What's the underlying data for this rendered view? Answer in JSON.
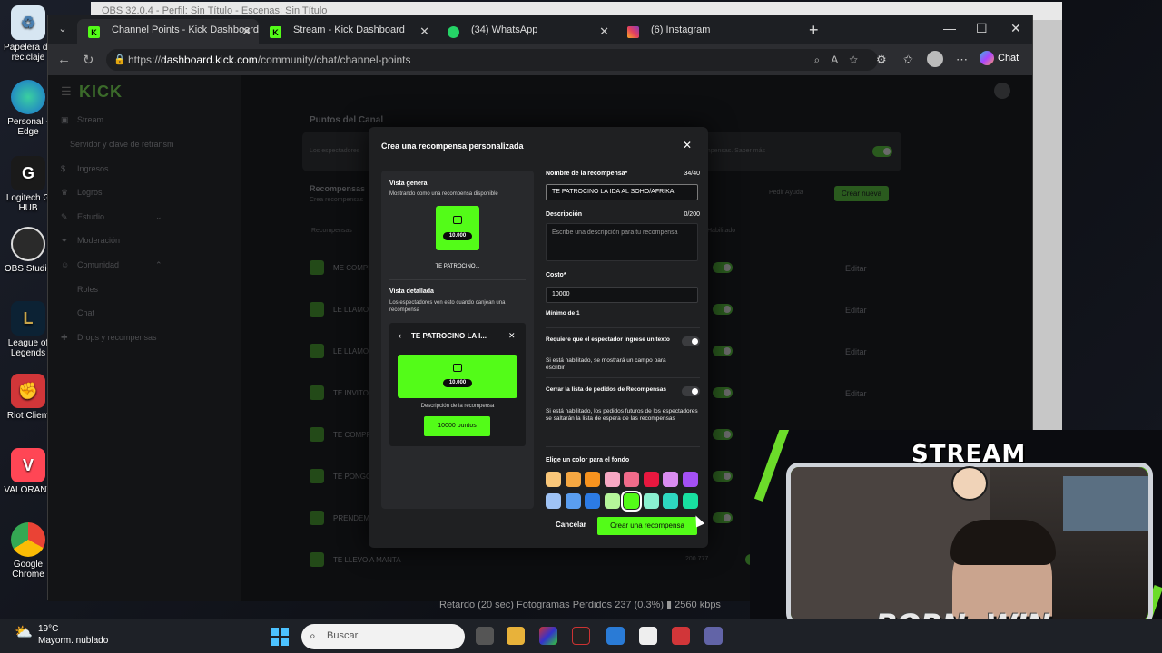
{
  "desktop": {
    "icons": [
      {
        "label": "Papelera de reciclaje",
        "icon": "recycle-bin-icon"
      },
      {
        "label": "Personal - Edge",
        "icon": "edge-icon"
      },
      {
        "label": "Logitech G HUB",
        "icon": "logitech-icon"
      },
      {
        "label": "OBS Studio",
        "icon": "obs-icon"
      },
      {
        "label": "League of Legends",
        "icon": "league-icon"
      },
      {
        "label": "Riot Client",
        "icon": "riot-icon"
      },
      {
        "label": "VALORANT",
        "icon": "valorant-icon"
      },
      {
        "label": "Google Chrome",
        "icon": "chrome-icon"
      }
    ],
    "obs_title": "OBS 32.0.4 - Perfil: Sin Título - Escenas: Sin Título",
    "obs_status": "Retardo (20 sec)   Fotogramas Perdidos 237 (0.3%)   ▮ 2560 kbps"
  },
  "browser": {
    "tabs": [
      {
        "label": "Channel Points - Kick Dashboard",
        "icon": "kick-favicon",
        "active": true
      },
      {
        "label": "Stream - Kick Dashboard",
        "icon": "kick-favicon",
        "active": false
      },
      {
        "label": "(34) WhatsApp",
        "icon": "whatsapp-favicon",
        "active": false
      },
      {
        "label": "(6) Instagram",
        "icon": "instagram-favicon",
        "active": false
      }
    ],
    "url_prefix": "https://",
    "url_host": "dashboard.kick.com",
    "url_path": "/community/chat/channel-points",
    "chat_label": "Chat"
  },
  "kick": {
    "logo": "KICK",
    "sidebar": [
      {
        "label": "Stream",
        "icon": "video-icon"
      },
      {
        "label": "Servidor y clave de retransm",
        "icon": ""
      },
      {
        "label": "Ingresos",
        "icon": "dollar-icon"
      },
      {
        "label": "Logros",
        "icon": "trophy-icon"
      },
      {
        "label": "Estudio",
        "icon": "brush-icon"
      },
      {
        "label": "Moderación",
        "icon": "wrench-icon"
      },
      {
        "label": "Comunidad",
        "icon": "people-icon"
      },
      {
        "label": "Roles",
        "icon": ""
      },
      {
        "label": "Chat",
        "icon": ""
      },
      {
        "label": "Drops y recompensas",
        "icon": "gift-icon"
      }
    ],
    "page_title": "Puntos del Canal",
    "intro_text": "Los espectadores",
    "intro_tail": "ompensas. Saber más",
    "rewards_title": "Recompensas",
    "rewards_sub": "Crea recompensas",
    "request_btn": "Pedir Ayuda",
    "create_btn": "Crear nueva",
    "col_label": "Recompensas",
    "col_status": "Habilitado",
    "rewards": [
      {
        "label": "ME COMPR",
        "edit": "Editar"
      },
      {
        "label": "LE LLAMO",
        "edit": "Editar"
      },
      {
        "label": "LE LLAMO",
        "edit": "Editar"
      },
      {
        "label": "TE INVITO",
        "edit": "Editar"
      },
      {
        "label": "TE COMPR",
        "edit": ""
      },
      {
        "label": "TE PONGO",
        "edit": ""
      },
      {
        "label": "PRENDEM",
        "edit": ""
      },
      {
        "label": "TE LLEVO A MANTA",
        "edit": "",
        "cost": "200.777"
      }
    ]
  },
  "modal": {
    "title": "Crea una recompensa personalizada",
    "overview_title": "Vista general",
    "overview_sub": "Mostrando como una recompensa disponible",
    "tile_cost": "10.000",
    "tile_name": "TE PATROCINO...",
    "detail_title": "Vista detallada",
    "detail_sub": "Los espectadores ven esto cuando canjean una recompensa",
    "detail_header": "TE PATROCINO LA I...",
    "detail_desc": "Descripción de la recompensa",
    "detail_points": "10000 puntos",
    "name_label": "Nombre de la recompensa*",
    "name_count": "34/40",
    "name_value": "TE PATROCINO LA IDA AL SOHO/AFRIKA",
    "desc_label": "Descripción",
    "desc_count": "0/200",
    "desc_placeholder": "Escribe una descripción para tu recompensa",
    "cost_label": "Costo*",
    "cost_value": "10000",
    "cost_min": "Mínimo de 1",
    "require_label": "Requiere que el espectador ingrese un texto",
    "require_help": "Si está habilitado, se mostrará un campo para escribir",
    "close_label": "Cerrar la lista de pedidos de Recompensas",
    "close_help": "Si está habilitado, los pedidos futuros de los espectadores se saltarán la lista de espera de las recompensas",
    "color_label": "Elige un color para el fondo",
    "colors_row1": [
      "#f9c77a",
      "#f5a742",
      "#f7931e",
      "#f7a8c4",
      "#f06b8a",
      "#e8183f",
      "#d98cf0",
      "#a450f5"
    ],
    "colors_row2": [
      "#9fc3f5",
      "#5a9ef0",
      "#2c7be5",
      "#b5f59a",
      "#53fc18",
      "#8af0d0",
      "#2ed8c0",
      "#18e0a0"
    ],
    "selected_color": "#53fc18",
    "cancel_label": "Cancelar",
    "create_label": "Crear una recompensa"
  },
  "overlay": {
    "top_text": "STREAM",
    "bottom_text_a": "BORN",
    "bottom_text_to": "TO",
    "bottom_text_b": "WIN"
  },
  "taskbar": {
    "temp": "19°C",
    "weather": "Mayorm. nublado",
    "search_placeholder": "Buscar"
  }
}
